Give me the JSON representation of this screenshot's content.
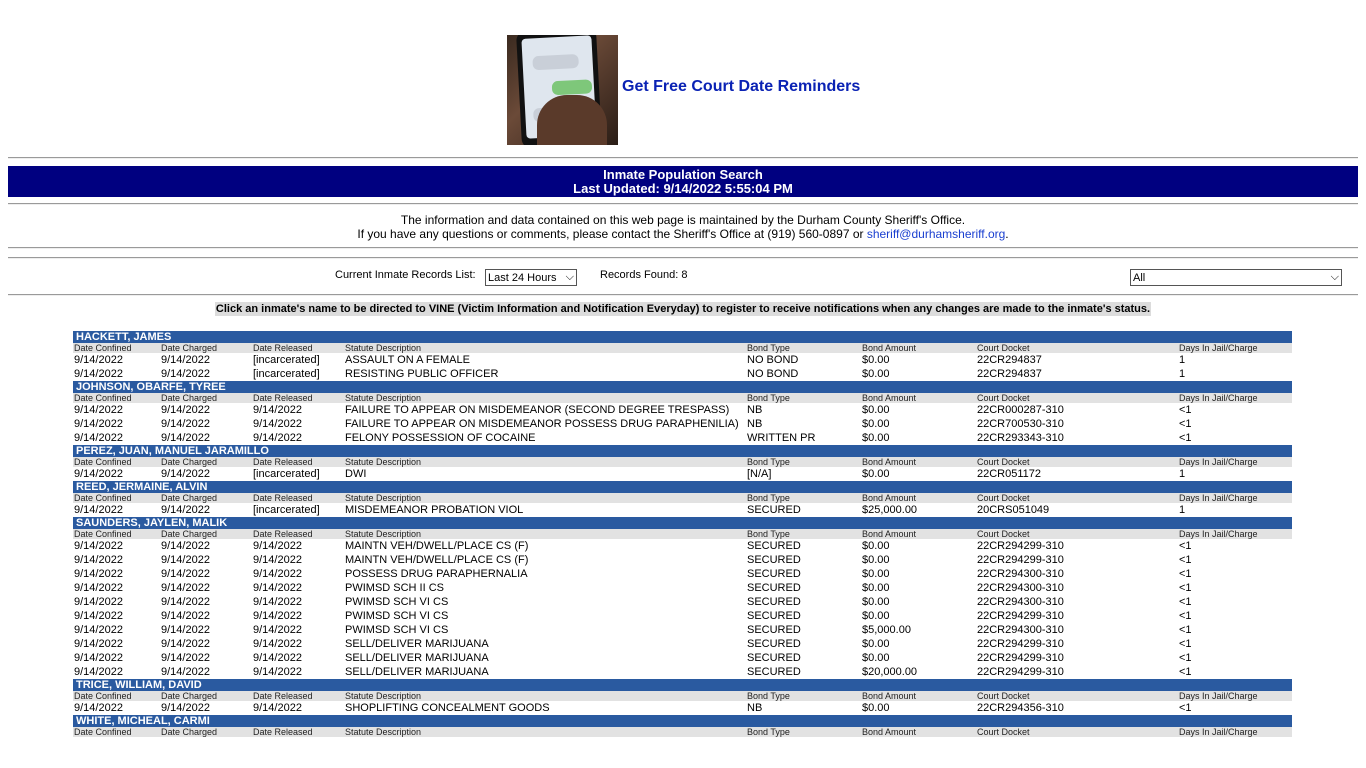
{
  "promo": {
    "link_text": "Get Free Court Date Reminders",
    "image_icon": "phone-text-message-image"
  },
  "banner": {
    "title": "Inmate Population Search",
    "updated": "Last Updated: 9/14/2022 5:55:04 PM"
  },
  "info": {
    "line1": "The information and data contained on this web page is maintained by the Durham County Sheriff's Office.",
    "line2_prefix": "If you have any questions or comments, please contact the Sheriff's Office at (919) 560-0897 or ",
    "email": "sheriff@durhamsheriff.org",
    "line2_suffix": "."
  },
  "controls": {
    "list_label": "Current Inmate Records List:",
    "list_value": "Last 24 Hours",
    "records_found": "Records Found: 8",
    "filter_value": "All"
  },
  "vine_note": "Click an inmate's name to be directed to VINE (Victim Information and Notification Everyday) to register to receive notifications when any changes are made to the inmate's status.",
  "columns": [
    "Date Confined",
    "Date Charged",
    "Date Released",
    "Statute Description",
    "Bond Type",
    "Bond Amount",
    "Court Docket",
    "Days In Jail/Charge"
  ],
  "inmates": [
    {
      "name": "HACKETT, JAMES",
      "charges": [
        [
          "9/14/2022",
          "9/14/2022",
          "[incarcerated]",
          "ASSAULT ON A FEMALE",
          "NO BOND",
          "$0.00",
          "22CR294837",
          "1"
        ],
        [
          "9/14/2022",
          "9/14/2022",
          "[incarcerated]",
          "RESISTING PUBLIC OFFICER",
          "NO BOND",
          "$0.00",
          "22CR294837",
          "1"
        ]
      ]
    },
    {
      "name": "JOHNSON, OBARFE, TYREE",
      "charges": [
        [
          "9/14/2022",
          "9/14/2022",
          "9/14/2022",
          "FAILURE TO APPEAR ON MISDEMEANOR (SECOND DEGREE TRESPASS)",
          "NB",
          "$0.00",
          "22CR000287-310",
          "<1"
        ],
        [
          "9/14/2022",
          "9/14/2022",
          "9/14/2022",
          "FAILURE TO APPEAR ON MISDEMEANOR POSSESS DRUG PARAPHENILIA)",
          "NB",
          "$0.00",
          "22CR700530-310",
          "<1"
        ],
        [
          "9/14/2022",
          "9/14/2022",
          "9/14/2022",
          "FELONY POSSESSION OF COCAINE",
          "WRITTEN PR",
          "$0.00",
          "22CR293343-310",
          "<1"
        ]
      ]
    },
    {
      "name": "PEREZ, JUAN, MANUEL JARAMILLO",
      "charges": [
        [
          "9/14/2022",
          "9/14/2022",
          "[incarcerated]",
          "DWI",
          "[N/A]",
          "$0.00",
          "22CR051172",
          "1"
        ]
      ]
    },
    {
      "name": "REED, JERMAINE, ALVIN",
      "charges": [
        [
          "9/14/2022",
          "9/14/2022",
          "[incarcerated]",
          "MISDEMEANOR PROBATION VIOL",
          "SECURED",
          "$25,000.00",
          "20CRS051049",
          "1"
        ]
      ]
    },
    {
      "name": "SAUNDERS, JAYLEN, MALIK",
      "charges": [
        [
          "9/14/2022",
          "9/14/2022",
          "9/14/2022",
          "MAINTN VEH/DWELL/PLACE CS (F)",
          "SECURED",
          "$0.00",
          "22CR294299-310",
          "<1"
        ],
        [
          "9/14/2022",
          "9/14/2022",
          "9/14/2022",
          "MAINTN VEH/DWELL/PLACE CS (F)",
          "SECURED",
          "$0.00",
          "22CR294299-310",
          "<1"
        ],
        [
          "9/14/2022",
          "9/14/2022",
          "9/14/2022",
          "POSSESS DRUG PARAPHERNALIA",
          "SECURED",
          "$0.00",
          "22CR294300-310",
          "<1"
        ],
        [
          "9/14/2022",
          "9/14/2022",
          "9/14/2022",
          "PWIMSD SCH II CS",
          "SECURED",
          "$0.00",
          "22CR294300-310",
          "<1"
        ],
        [
          "9/14/2022",
          "9/14/2022",
          "9/14/2022",
          "PWIMSD SCH VI CS",
          "SECURED",
          "$0.00",
          "22CR294300-310",
          "<1"
        ],
        [
          "9/14/2022",
          "9/14/2022",
          "9/14/2022",
          "PWIMSD SCH VI CS",
          "SECURED",
          "$0.00",
          "22CR294299-310",
          "<1"
        ],
        [
          "9/14/2022",
          "9/14/2022",
          "9/14/2022",
          "PWIMSD SCH VI CS",
          "SECURED",
          "$5,000.00",
          "22CR294300-310",
          "<1"
        ],
        [
          "9/14/2022",
          "9/14/2022",
          "9/14/2022",
          "SELL/DELIVER MARIJUANA",
          "SECURED",
          "$0.00",
          "22CR294299-310",
          "<1"
        ],
        [
          "9/14/2022",
          "9/14/2022",
          "9/14/2022",
          "SELL/DELIVER MARIJUANA",
          "SECURED",
          "$0.00",
          "22CR294299-310",
          "<1"
        ],
        [
          "9/14/2022",
          "9/14/2022",
          "9/14/2022",
          "SELL/DELIVER MARIJUANA",
          "SECURED",
          "$20,000.00",
          "22CR294299-310",
          "<1"
        ]
      ]
    },
    {
      "name": "TRICE, WILLIAM, DAVID",
      "charges": [
        [
          "9/14/2022",
          "9/14/2022",
          "9/14/2022",
          "SHOPLIFTING CONCEALMENT GOODS",
          "NB",
          "$0.00",
          "22CR294356-310",
          "<1"
        ]
      ]
    },
    {
      "name": "WHITE, MICHEAL, CARMI",
      "charges": []
    }
  ],
  "colors": {
    "banner": "#000080",
    "name_bar": "#2a5aa0",
    "header_bar": "#e2e2e2",
    "link": "#0a22b4"
  }
}
